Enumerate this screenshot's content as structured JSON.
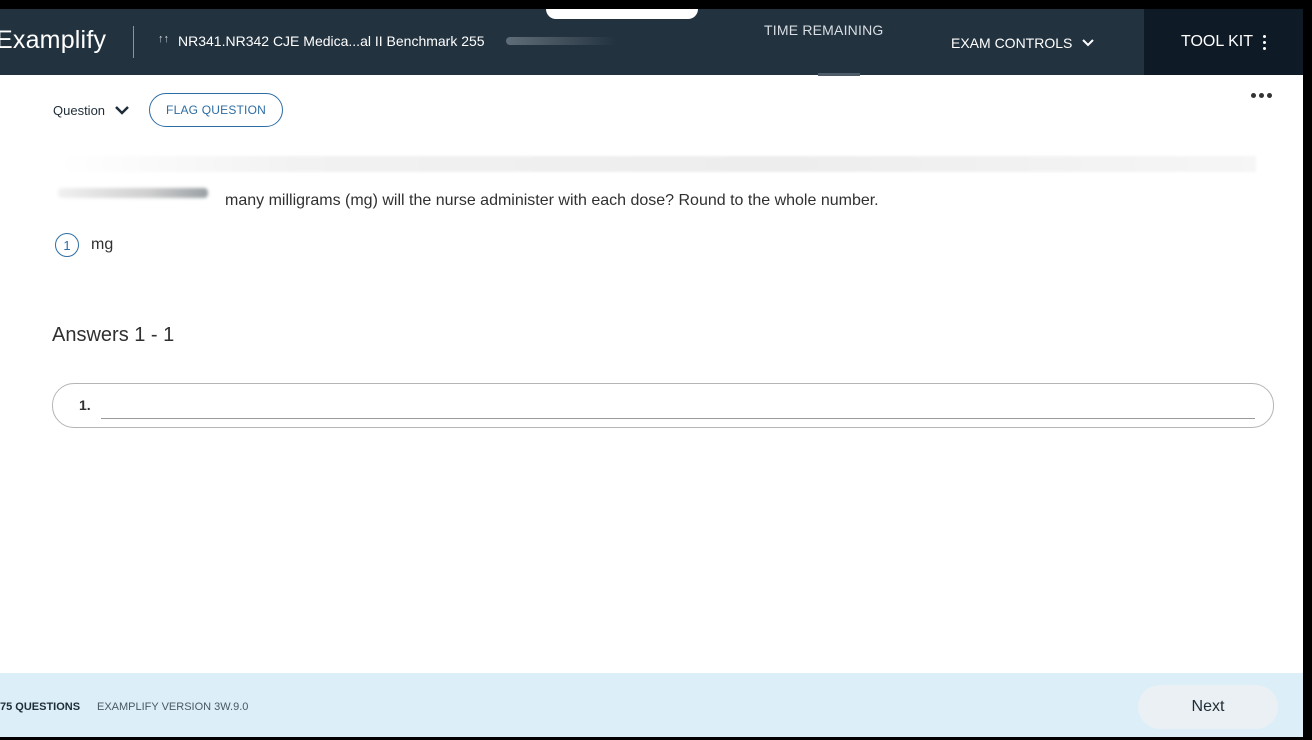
{
  "header": {
    "brand": "Examplify",
    "course_icon": "↑↑",
    "course_title": "NR341.NR342 CJE Medica...al II Benchmark 255",
    "time_label": "TIME REMAINING",
    "exam_controls": "EXAM CONTROLS",
    "tool_kit": "TOOL KIT"
  },
  "question": {
    "label": "Question",
    "flag_button": "FLAG QUESTION",
    "text": "many milligrams (mg) will the nurse administer with each dose? Round to the whole number.",
    "response_number": "1",
    "response_unit": "mg"
  },
  "answers": {
    "title": "Answers 1 - 1",
    "items": [
      {
        "number": "1.",
        "value": ""
      }
    ]
  },
  "footer": {
    "question_count": "75 QUESTIONS",
    "version": "EXAMPLIFY VERSION 3W.9.0",
    "next_button": "Next"
  },
  "colors": {
    "header_bg": "#22323f",
    "toolkit_bg": "#0e1b26",
    "accent": "#2e6da4",
    "footer_bg": "#dceef8"
  }
}
